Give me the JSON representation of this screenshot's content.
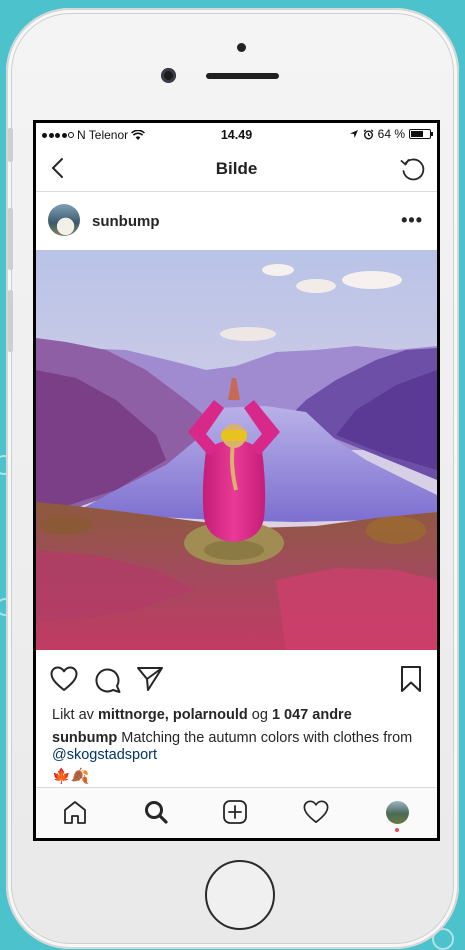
{
  "status_bar": {
    "carrier": "N Telenor",
    "time": "14.49",
    "battery": "64 %",
    "battery_level": 0.64
  },
  "nav": {
    "title": "Bilde",
    "back_icon": "chevron-left-icon",
    "refresh_icon": "refresh-icon"
  },
  "post": {
    "username": "sunbump",
    "more_label": "•••",
    "likes": {
      "prefix": "Likt av ",
      "names": "mittnorge, polarnould",
      "mid": " og ",
      "count": "1 047 andre"
    },
    "caption": {
      "user": "sunbump",
      "text": " Matching the autumn colors with clothes from ",
      "mention": "@skogstadsport",
      "emojis": "🍁🍂"
    }
  },
  "tabs": [
    {
      "name": "home",
      "icon": "home-icon"
    },
    {
      "name": "search",
      "icon": "search-icon"
    },
    {
      "name": "add",
      "icon": "plus-square-icon"
    },
    {
      "name": "activity",
      "icon": "heart-icon"
    },
    {
      "name": "profile",
      "icon": "avatar"
    }
  ],
  "colors": {
    "background": "#4cc3cc",
    "mention": "#003569",
    "notification_dot": "#ed4956"
  }
}
